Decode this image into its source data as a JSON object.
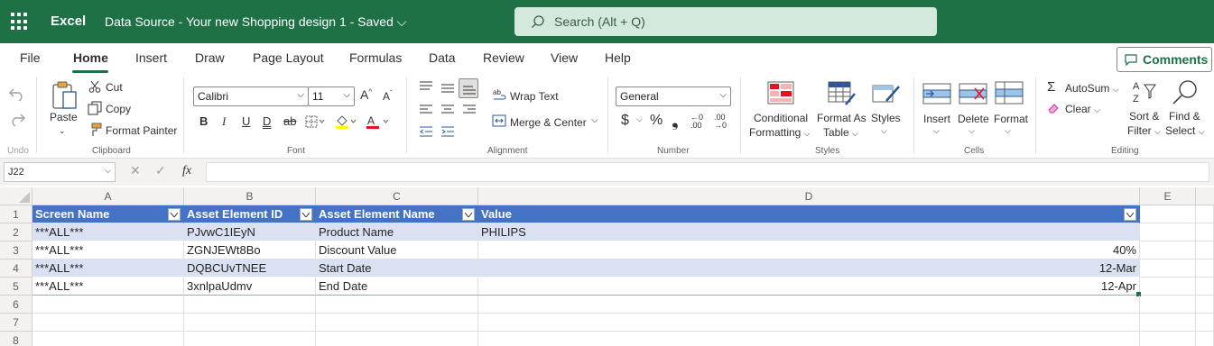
{
  "titlebar": {
    "app_name": "Excel",
    "doc_title": "Data Source - Your new Shopping design 1  -  Saved",
    "search_placeholder": "Search (Alt + Q)",
    "bg_color": "#1e7145"
  },
  "ribbon_tabs": [
    "File",
    "Home",
    "Insert",
    "Draw",
    "Page Layout",
    "Formulas",
    "Data",
    "Review",
    "View",
    "Help"
  ],
  "active_tab": "Home",
  "comments_label": "Comments",
  "ribbon": {
    "undo": {
      "group": "Undo"
    },
    "clipboard": {
      "paste": "Paste",
      "cut": "Cut",
      "copy": "Copy",
      "format_painter": "Format Painter",
      "group": "Clipboard"
    },
    "font": {
      "family": "Calibri",
      "size": "11",
      "group": "Font"
    },
    "alignment": {
      "wrap_text": "Wrap Text",
      "merge_center": "Merge & Center",
      "group": "Alignment"
    },
    "number": {
      "format": "General",
      "group": "Number"
    },
    "styles": {
      "conditional_1": "Conditional",
      "conditional_2": "Formatting",
      "format_as_1": "Format As",
      "format_as_2": "Table",
      "styles": "Styles",
      "group": "Styles"
    },
    "cells": {
      "insert": "Insert",
      "delete": "Delete",
      "format": "Format",
      "group": "Cells"
    },
    "editing": {
      "autosum": "AutoSum",
      "clear": "Clear",
      "sort_1": "Sort &",
      "sort_2": "Filter",
      "find_1": "Find &",
      "find_2": "Select",
      "group": "Editing"
    }
  },
  "formula_bar": {
    "name_box": "J22",
    "formula": ""
  },
  "sheet": {
    "columns": [
      "A",
      "B",
      "C",
      "D",
      "E"
    ],
    "rows": [
      "1",
      "2",
      "3",
      "4",
      "5",
      "6",
      "7",
      "8"
    ],
    "table_headers": [
      "Screen Name",
      "Asset Element ID",
      "Asset Element Name",
      "Value"
    ],
    "table_rows": [
      [
        "***ALL***",
        "PJvwC1IEyN",
        "Product Name",
        "PHILIPS"
      ],
      [
        "***ALL***",
        "ZGNJEWt8Bo",
        "Discount Value",
        "40%"
      ],
      [
        "***ALL***",
        "DQBCUvTNEE",
        "Start Date",
        "12-Mar"
      ],
      [
        "***ALL***",
        "3xnlpaUdmv",
        "End Date",
        "12-Apr"
      ]
    ],
    "header_color": "#4472c4",
    "band_color": "#d9e1f2"
  }
}
